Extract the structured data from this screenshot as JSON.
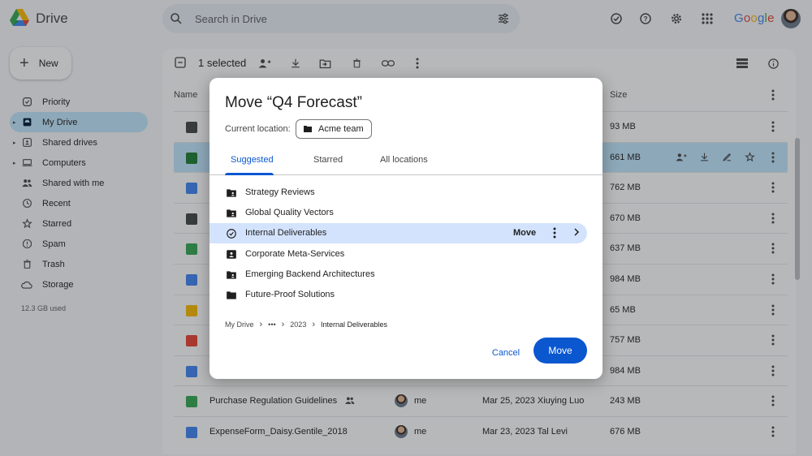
{
  "app": {
    "brand": "Drive",
    "google": "Google"
  },
  "search": {
    "placeholder": "Search in Drive"
  },
  "sidebar": {
    "new_label": "New",
    "items": [
      {
        "label": "Priority",
        "icon": "checkbox-circle-icon"
      },
      {
        "label": "My Drive",
        "icon": "my-drive-icon"
      },
      {
        "label": "Shared drives",
        "icon": "shared-drives-icon"
      },
      {
        "label": "Computers",
        "icon": "computer-icon"
      },
      {
        "label": "Shared with me",
        "icon": "people-icon"
      },
      {
        "label": "Recent",
        "icon": "clock-icon"
      },
      {
        "label": "Starred",
        "icon": "star-icon"
      },
      {
        "label": "Spam",
        "icon": "spam-icon"
      },
      {
        "label": "Trash",
        "icon": "trash-icon"
      },
      {
        "label": "Storage",
        "icon": "cloud-icon"
      }
    ],
    "storage_used": "12.3 GB used"
  },
  "toolbar": {
    "selected_label": "1 selected"
  },
  "file_list": {
    "col_name": "Name",
    "col_size": "Size",
    "rows": [
      {
        "name": "",
        "size": "93 MB",
        "icon_color": "#444746"
      },
      {
        "name": "",
        "size": "661 MB",
        "icon_color": "#1e7e34",
        "selected": true
      },
      {
        "name": "",
        "size": "762 MB",
        "icon_color": "#4285f4"
      },
      {
        "name": "",
        "size": "670 MB",
        "icon_color": "#444746"
      },
      {
        "name": "",
        "size": "637 MB",
        "icon_color": "#34a853"
      },
      {
        "name": "",
        "size": "984 MB",
        "icon_color": "#4285f4"
      },
      {
        "name": "",
        "size": "65 MB",
        "icon_color": "#fbbc04"
      },
      {
        "name": "",
        "size": "757 MB",
        "icon_color": "#ea4335"
      },
      {
        "name": "",
        "size": "984 MB",
        "icon_color": "#4285f4"
      },
      {
        "name": "Purchase Regulation Guidelines",
        "owner": "me",
        "modified": "Mar 25, 2023 Xiuying Luo",
        "size": "243 MB",
        "icon_color": "#34a853",
        "shared": true
      },
      {
        "name": "ExpenseForm_Daisy.Gentile_2018",
        "owner": "me",
        "modified": "Mar 23, 2023 Tal Levi",
        "size": "676 MB",
        "icon_color": "#4285f4"
      }
    ]
  },
  "dialog": {
    "title": "Move “Q4 Forecast”",
    "current_location_label": "Current location:",
    "current_location": "Acme team",
    "tabs": [
      "Suggested",
      "Starred",
      "All locations"
    ],
    "folders": [
      {
        "name": "Strategy Reviews",
        "icon": "shared-folder-icon"
      },
      {
        "name": "Global Quality Vectors",
        "icon": "shared-folder-icon"
      },
      {
        "name": "Internal Deliverables",
        "icon": "check-circle-icon",
        "highlighted": true,
        "action": "Move"
      },
      {
        "name": "Corporate Meta-Services",
        "icon": "shared-drive-icon"
      },
      {
        "name": "Emerging Backend Architectures",
        "icon": "shared-folder-icon"
      },
      {
        "name": "Future-Proof Solutions",
        "icon": "folder-icon"
      }
    ],
    "breadcrumb": [
      "My Drive",
      "•••",
      "2023",
      "Internal Deliverables"
    ],
    "cancel_label": "Cancel",
    "move_label": "Move"
  },
  "colors": {
    "accent": "#0b57d0",
    "selection": "#c2e7ff",
    "highlight": "#d3e3fd"
  }
}
